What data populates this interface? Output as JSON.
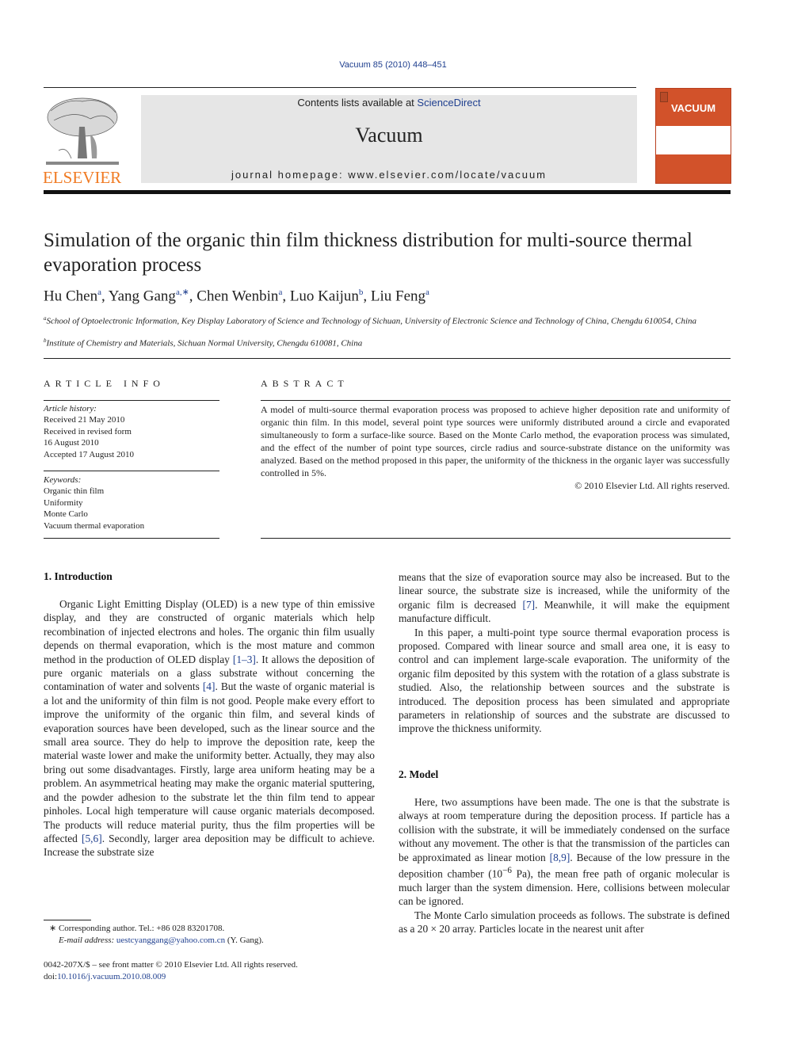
{
  "header": {
    "citation": "Vacuum 85 (2010) 448–451",
    "contents_prefix": "Contents lists available at ",
    "contents_link": "ScienceDirect",
    "journal_title": "Vacuum",
    "homepage": "journal homepage: www.elsevier.com/locate/vacuum",
    "publisher_logo_text": "ELSEVIER",
    "cover_title": "VACUUM",
    "colors": {
      "publisher_orange": "#f07a22",
      "cover_orange": "#d2522a",
      "link_blue": "#1f3f8f",
      "banner_gray": "#e6e6e6"
    }
  },
  "article": {
    "title": "Simulation of the organic thin film thickness distribution for multi-source thermal evaporation process",
    "authors": [
      {
        "name": "Hu Chen",
        "sup": "a"
      },
      {
        "name": "Yang Gang",
        "sup": "a,∗"
      },
      {
        "name": "Chen Wenbin",
        "sup": "a"
      },
      {
        "name": "Luo Kaijun",
        "sup": "b"
      },
      {
        "name": "Liu Feng",
        "sup": "a"
      }
    ],
    "affiliations": [
      {
        "sup": "a",
        "text": "School of Optoelectronic Information, Key Display Laboratory of Science and Technology of Sichuan, University of Electronic Science and Technology of China, Chengdu 610054, China"
      },
      {
        "sup": "b",
        "text": "Institute of Chemistry and Materials, Sichuan Normal University, Chengdu 610081, China"
      }
    ]
  },
  "article_info": {
    "heading": "ARTICLE INFO",
    "history_label": "Article history:",
    "history": [
      "Received 21 May 2010",
      "Received in revised form",
      "16 August 2010",
      "Accepted 17 August 2010"
    ],
    "keywords_label": "Keywords:",
    "keywords": [
      "Organic thin film",
      "Uniformity",
      "Monte Carlo",
      "Vacuum thermal evaporation"
    ]
  },
  "abstract": {
    "heading": "ABSTRACT",
    "text": "A model of multi-source thermal evaporation process was proposed to achieve higher deposition rate and uniformity of organic thin film. In this model, several point type sources were uniformly distributed around a circle and evaporated simultaneously to form a surface-like source. Based on the Monte Carlo method, the evaporation process was simulated, and the effect of the number of point type sources, circle radius and source-substrate distance on the uniformity was analyzed. Based on the method proposed in this paper, the uniformity of the thickness in the organic layer was successfully controlled in 5%.",
    "copyright": "© 2010 Elsevier Ltd. All rights reserved."
  },
  "sections": {
    "intro_heading": "1.  Introduction",
    "intro_p1": [
      "Organic Light Emitting Display (OLED) is a new type of thin emissive display, and they are constructed of organic materials which help recombination of injected electrons and holes. The organic thin film usually depends on thermal evaporation, which is the most mature and common method in the production of OLED display ",
      "[1–3]",
      ". It allows the deposition of pure organic materials on a glass substrate without concerning the contamination of water and solvents ",
      "[4]",
      ". But the waste of organic material is a lot and the uniformity of thin film is not good. People make every effort to improve the uniformity of the organic thin film, and several kinds of evaporation sources have been developed, such as the linear source and the small area source. They do help to improve the deposition rate, keep the material waste lower and make the uniformity better. Actually, they may also bring out some disadvantages. Firstly, large area uniform heating may be a problem. An asymmetrical heating may make the organic material sputtering, and the powder adhesion to the substrate let the thin film tend to appear pinholes. Local high temperature will cause organic materials decomposed. The products will reduce material purity, thus the film properties will be affected ",
      "[5,6]",
      ". Secondly, larger area deposition may be difficult to achieve. Increase the substrate size"
    ],
    "intro_p1_cont": [
      "means that the size of evaporation source may also be increased. But to the linear source, the substrate size is increased, while the uniformity of the organic film is decreased ",
      "[7]",
      ". Meanwhile, it will make the equipment manufacture difficult."
    ],
    "intro_p2": "In this paper, a multi-point type source thermal evaporation process is proposed. Compared with linear source and small area one, it is easy to control and can implement large-scale evaporation. The uniformity of the organic film deposited by this system with the rotation of a glass substrate is studied. Also, the relationship between sources and the substrate is introduced. The deposition process has been simulated and appropriate parameters in relationship of sources and the substrate are discussed to improve the thickness uniformity.",
    "model_heading": "2.  Model",
    "model_p1": [
      "Here, two assumptions have been made. The one is that the substrate is always at room temperature during the deposition process. If particle has a collision with the substrate, it will be immediately condensed on the surface without any movement. The other is that the transmission of the particles can be approximated as linear motion ",
      "[8,9]",
      ". Because of the low pressure in the deposition chamber (10",
      "−6",
      " Pa), the mean free path of organic molecular is much larger than the system dimension. Here, collisions between molecular can be ignored."
    ],
    "model_p2": "The Monte Carlo simulation proceeds as follows. The substrate is defined as a 20 × 20 array. Particles locate in the nearest unit after"
  },
  "footnotes": {
    "corresponding": "∗  Corresponding author. Tel.: +86 028 83201708.",
    "email_label": "E-mail address: ",
    "email": "uestcyanggang@yahoo.com.cn",
    "email_suffix": " (Y. Gang).",
    "front_matter": "0042-207X/$ – see front matter © 2010 Elsevier Ltd. All rights reserved.",
    "doi_label": "doi:",
    "doi": "10.1016/j.vacuum.2010.08.009"
  }
}
